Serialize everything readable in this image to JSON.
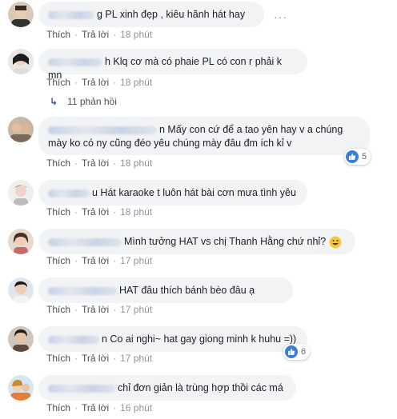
{
  "actions": {
    "like": "Thích",
    "reply": "Trả lời",
    "sep": "·"
  },
  "comments": [
    {
      "text": "g PL xinh đẹp , kiêu hãnh hát hay",
      "time": "18 phút"
    },
    {
      "text": "h Klq cơ mà có phaie PL có con r phải k mn",
      "time": "18 phút",
      "replies": "11 phản hồi"
    },
    {
      "text_line1": "n Mấy con cứ để a tao yên hay v    a chúng",
      "text_line2": "mày ko có ny cũng đéo yêu chúng mày đâu đm ích kỉ v",
      "time": "18 phút",
      "likes": "5"
    },
    {
      "text": "u Hát karaoke t luôn hát bài cơn mưa tình yêu",
      "time": "18 phút"
    },
    {
      "text": "Mình tưởng HAT vs chị Thanh Hằng chứ nhỉ?",
      "time": "17 phút"
    },
    {
      "text": "HAT đâu thích bánh bèo đâu ạ",
      "time": "17 phút"
    },
    {
      "text": "n Co ai nghi~ hat gay giong minh k huhu =))",
      "time": "17 phút",
      "likes": "6"
    },
    {
      "text": "chỉ đơn giản là trùng hợp thồi các má",
      "time": "16 phút"
    }
  ]
}
